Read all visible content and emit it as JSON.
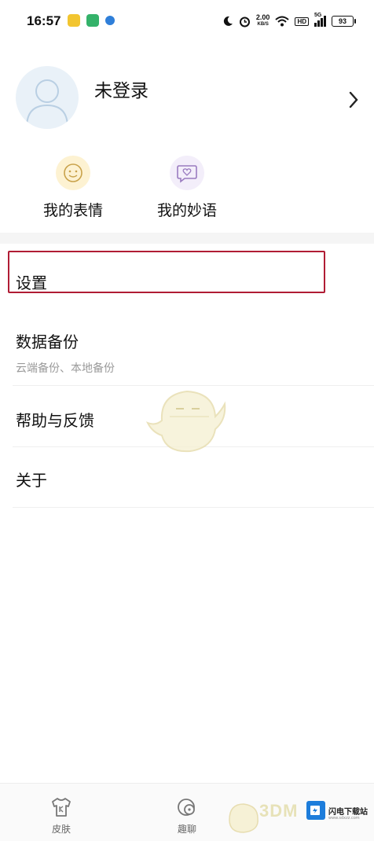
{
  "status_bar": {
    "time": "16:57",
    "net_speed": "2.00",
    "net_speed_unit": "KB/S",
    "hd_label": "HD",
    "network_label": "5G",
    "battery": "93",
    "app_icon_colors": [
      "#f2c530",
      "#34b26a",
      "#2f7fd9"
    ]
  },
  "profile": {
    "login_status": "未登录"
  },
  "quick_actions": [
    {
      "label": "我的表情",
      "icon": "smile-face-icon",
      "color": "#fbe9b3"
    },
    {
      "label": "我的妙语",
      "icon": "heart-chat-bubble-icon",
      "color": "#ece3f7"
    }
  ],
  "menu": [
    {
      "title": "设置"
    },
    {
      "title": "数据备份",
      "subtitle": "云端备份、本地备份"
    },
    {
      "title": "帮助与反馈"
    },
    {
      "title": "关于"
    }
  ],
  "highlight_color": "#b01c34",
  "bottom_nav": [
    {
      "label": "皮肤",
      "icon": "shirt-icon"
    },
    {
      "label": "趣聊",
      "icon": "chat-bubble-icon"
    }
  ],
  "watermark": {
    "brand_text": "闪电下载站",
    "site_text": "www.sdxzz.com",
    "partial_logo_text": "3DM"
  }
}
